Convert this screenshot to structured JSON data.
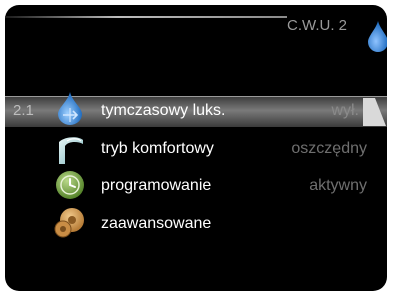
{
  "header": {
    "title": "C.W.U.  2",
    "icon": "water-drop-icon"
  },
  "menu": {
    "items": [
      {
        "number": "2.1",
        "label": "tymczasowy luks.",
        "value": "wył.",
        "icon": "drop-with-arrows-icon",
        "selected": true
      },
      {
        "number": "",
        "label": "tryb komfortowy",
        "value": "oszczędny",
        "icon": "faucet-icon",
        "selected": false
      },
      {
        "number": "",
        "label": "programowanie",
        "value": "aktywny",
        "icon": "clock-icon",
        "selected": false
      },
      {
        "number": "",
        "label": "zaawansowane",
        "value": "",
        "icon": "gears-icon",
        "selected": false
      }
    ]
  },
  "colors": {
    "background": "#000000",
    "selected_row": "#7a7a7a",
    "text": "#ffffff",
    "value_text": "#6f6f6f",
    "drop": "#2f7fd0"
  }
}
